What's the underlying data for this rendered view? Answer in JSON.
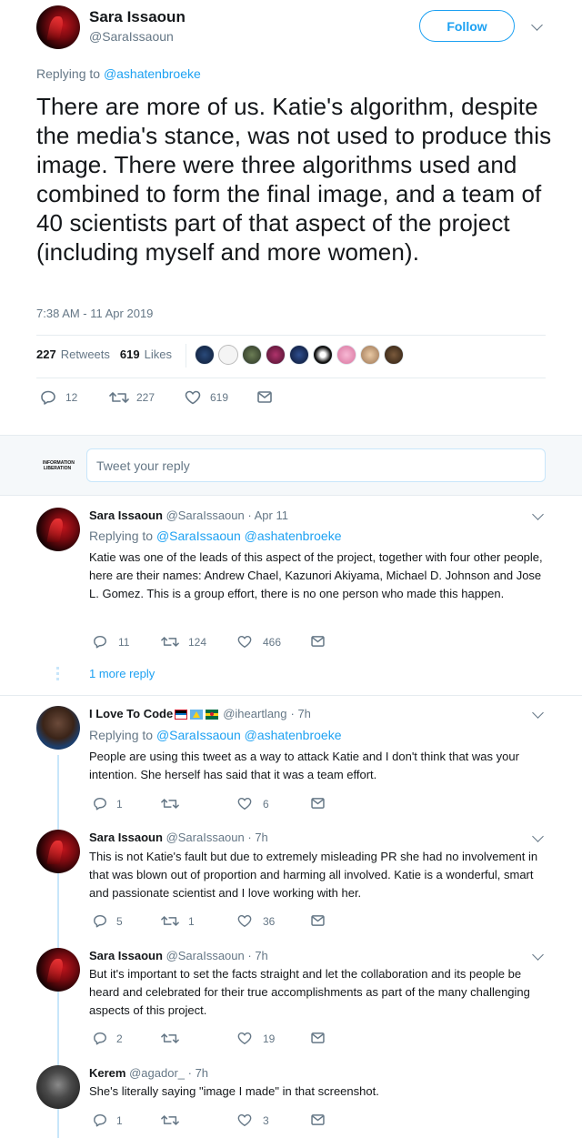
{
  "main_tweet": {
    "author_name": "Sara Issaoun",
    "author_handle": "@SaraIssaoun",
    "follow_label": "Follow",
    "replying_prefix": "Replying to",
    "replying_to": "@ashatenbroeke",
    "text": "There are more of us. Katie's algorithm, despite the media's stance, was not used to produce this image. There were three algorithms used and combined to form the final image, and a team of 40 scientists part of that aspect of the project (including myself and more women).",
    "timestamp": "7:38 AM - 11 Apr 2019",
    "retweets_count": "227",
    "retweets_label": "Retweets",
    "likes_count": "619",
    "likes_label": "Likes",
    "actions": {
      "replies": "12",
      "retweets": "227",
      "likes": "619"
    }
  },
  "reply_composer": {
    "avatar_text": "INFORMATION LIBERATION",
    "placeholder": "Tweet your reply"
  },
  "replies": [
    {
      "author_name": "Sara Issaoun",
      "author_handle": "@SaraIssaoun",
      "time": "· Apr 11",
      "replying_prefix": "Replying to",
      "replying_to": "@SaraIssaoun @ashatenbroeke",
      "text": "Katie was one of the leads of this aspect of the project, together with four other people, here are their names: Andrew Chael, Kazunori Akiyama, Michael D. Johnson and Jose L. Gomez. This is a group effort, there is no one person who made this happen.",
      "replies": "11",
      "retweets": "124",
      "likes": "466",
      "more_replies": "1 more reply"
    },
    {
      "author_name": "I Love To Code",
      "author_handle": "@iheartlang",
      "time": "· 7h",
      "replying_prefix": "Replying to",
      "replying_to": "@SaraIssaoun @ashatenbroeke",
      "text": "People are using this tweet as a way to attack Katie and I don't think that was your intention. She herself has said that it was a team effort.",
      "replies": "1",
      "retweets": "",
      "likes": "6"
    },
    {
      "author_name": "Sara Issaoun",
      "author_handle": "@SaraIssaoun",
      "time": "· 7h",
      "text": "This is not Katie's fault but due to extremely misleading PR she had no involvement in that was blown out of  proportion and harming all involved. Katie is a wonderful, smart and passionate scientist and I love working with her.",
      "replies": "5",
      "retweets": "1",
      "likes": "36"
    },
    {
      "author_name": "Sara Issaoun",
      "author_handle": "@SaraIssaoun",
      "time": "· 7h",
      "text": "But it's important to set the facts straight and let the collaboration and its people be heard and celebrated for their true accomplishments as part of the many challenging aspects of this project.",
      "replies": "2",
      "retweets": "",
      "likes": "19"
    },
    {
      "author_name": "Kerem",
      "author_handle": "@agador_",
      "time": "· 7h",
      "text": "She's literally saying \"image I made\" in that screenshot.",
      "replies": "1",
      "retweets": "",
      "likes": "3"
    }
  ],
  "colors": {
    "accent": "#1da1f2",
    "text": "#14171a",
    "muted": "#657786",
    "border": "#e6ecf0",
    "thread": "#c8e6fa"
  }
}
